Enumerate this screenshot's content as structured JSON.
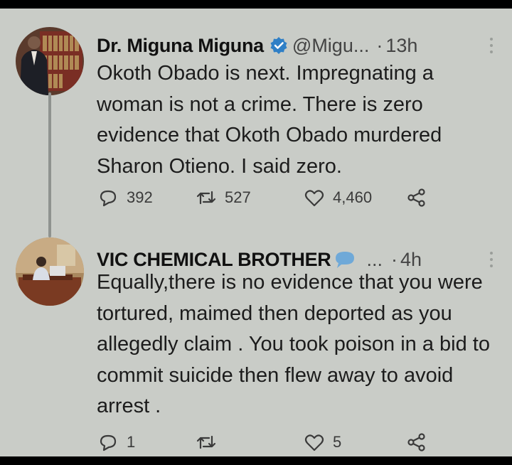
{
  "tweets": [
    {
      "author_name": "Dr. Miguna Miguna",
      "handle": "@Migu...",
      "separator": "·",
      "time": "13h",
      "text": "Okoth Obado is next. Impregnating a woman is not a crime. There is zero evidence that Okoth Obado murdered Sharon Otieno. I said zero.",
      "replies": "392",
      "retweets": "527",
      "likes": "4,460"
    },
    {
      "author_name": "VIC CHEMICAL BROTHER",
      "handle": "...",
      "separator": "·",
      "time": "4h",
      "text": "Equally,there is no evidence that you were tortured, maimed then deported as you allegedly claim . You took poison in a bid to commit suicide then flew away to avoid arrest .",
      "replies": "1",
      "retweets": "",
      "likes": "5"
    }
  ],
  "colors": {
    "background": "#c9ccc7",
    "verified_badge": "#2f7fc6",
    "emoji_bubble": "#6fa9d8"
  },
  "icons": [
    "reply-icon",
    "retweet-icon",
    "like-icon",
    "share-icon",
    "verified-badge-icon",
    "speech-bubble-emoji",
    "more-options-icon"
  ]
}
